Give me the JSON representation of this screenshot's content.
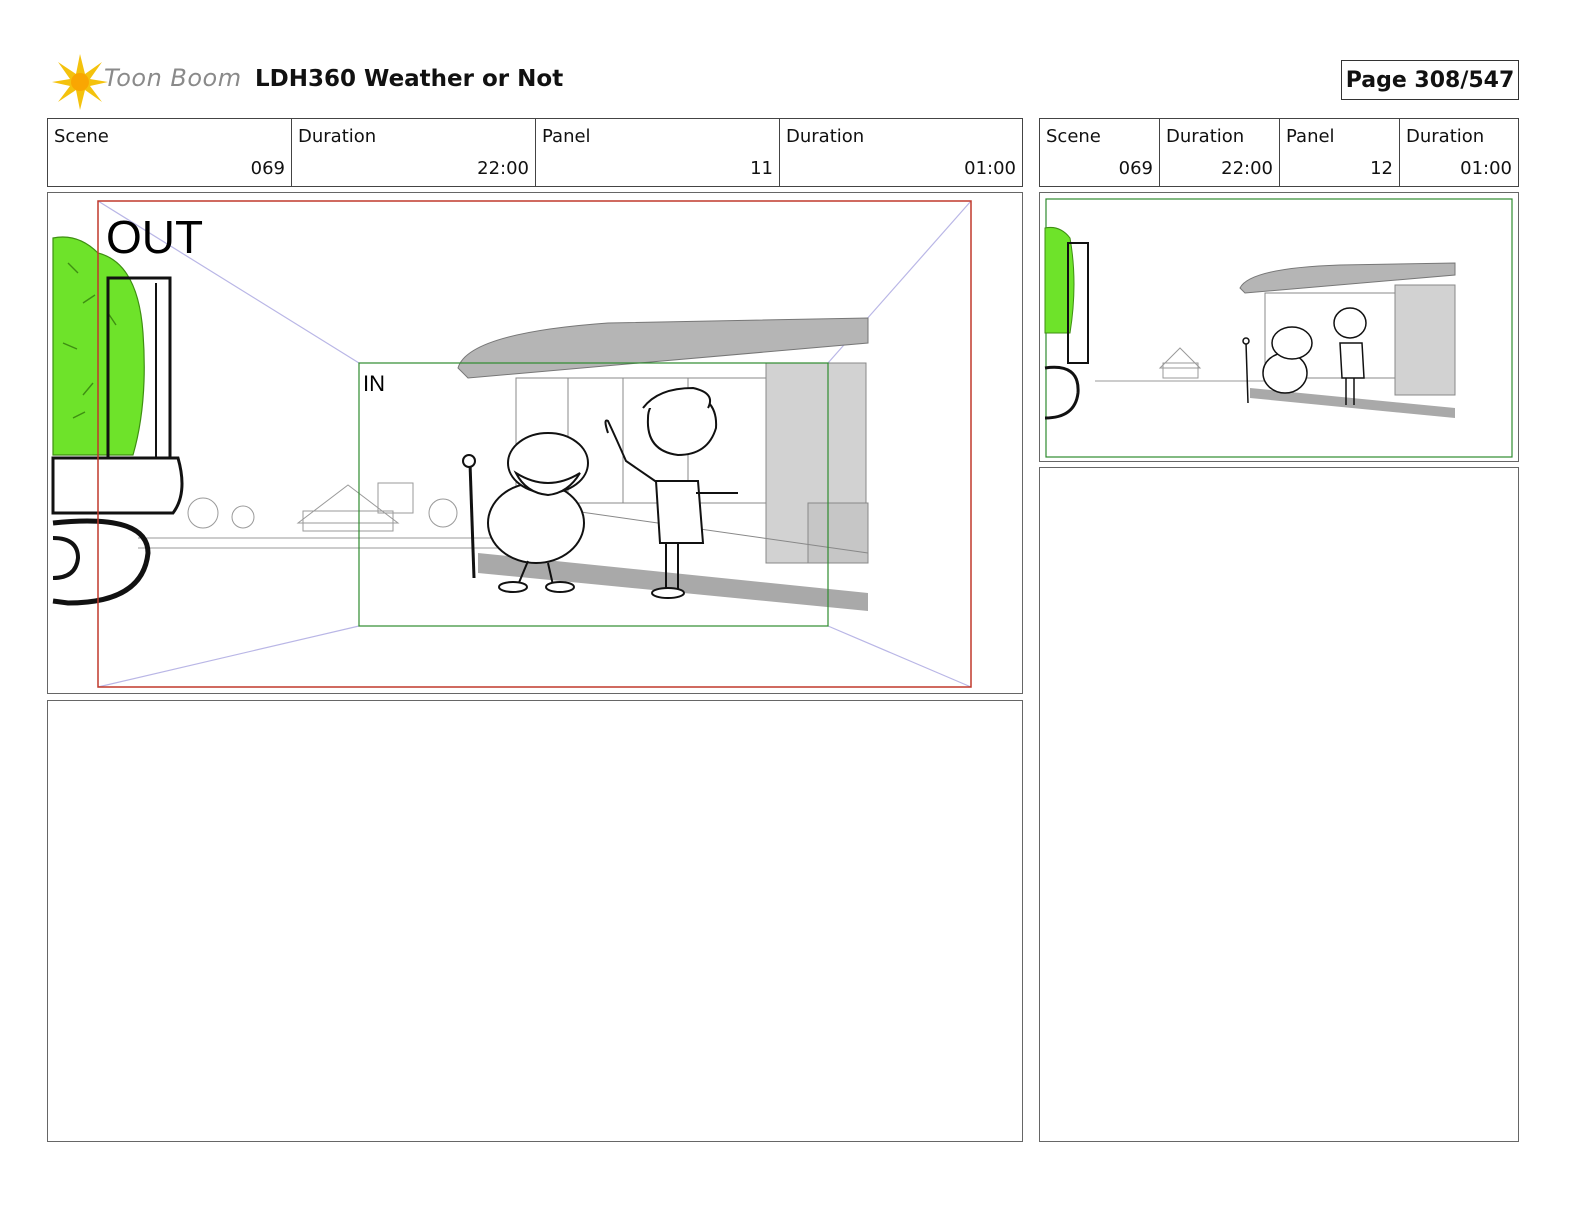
{
  "header": {
    "logo_text": "Toon Boom",
    "title": "LDH360 Weather or Not",
    "page": "Page 308/547"
  },
  "left_panel": {
    "info": [
      {
        "label": "Scene",
        "value": "069"
      },
      {
        "label": "Duration",
        "value": "22:00"
      },
      {
        "label": "Panel",
        "value": "11"
      },
      {
        "label": "Duration",
        "value": "01:00"
      }
    ],
    "out_label": "OUT",
    "in_label": "IN"
  },
  "right_panel": {
    "info": [
      {
        "label": "Scene",
        "value": "069"
      },
      {
        "label": "Duration",
        "value": "22:00"
      },
      {
        "label": "Panel",
        "value": "12"
      },
      {
        "label": "Duration",
        "value": "01:00"
      }
    ]
  },
  "colors": {
    "out_frame": "#c0392b",
    "in_frame": "#2e8b2e",
    "bush": "#6ee32a",
    "shadow_gray": "#a9a9a9"
  }
}
